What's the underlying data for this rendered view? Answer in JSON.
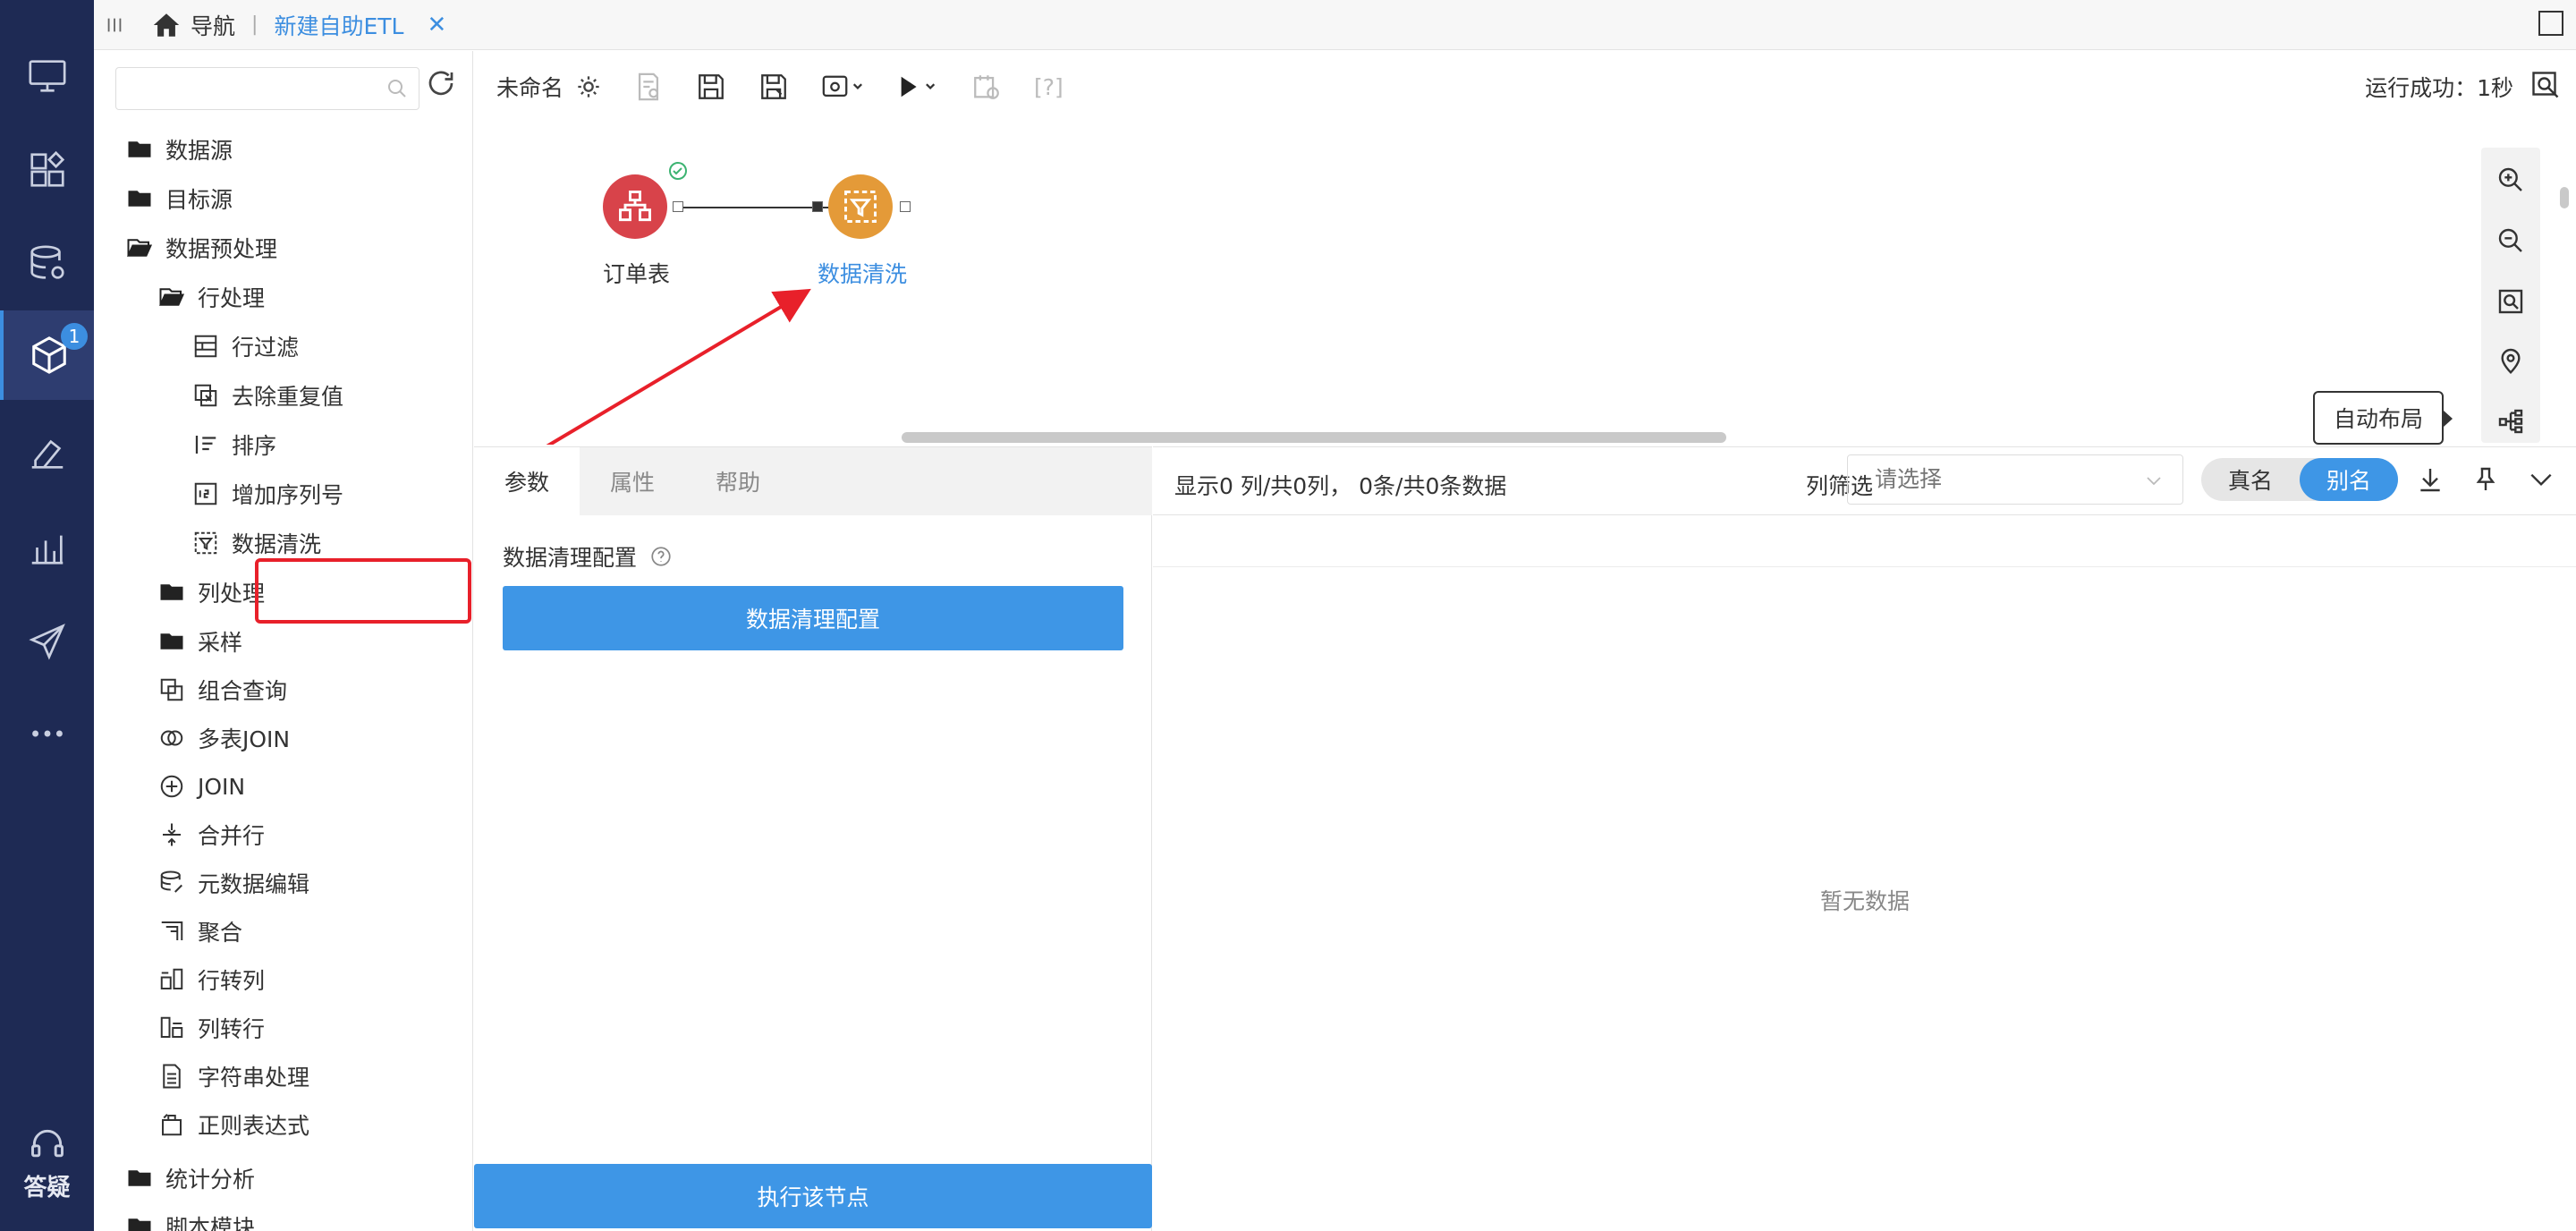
{
  "rail": {
    "badge_count": "1",
    "bottom_label": "答疑",
    "items": [
      "monitor-icon",
      "dashboard-icon",
      "database-settings-icon",
      "cube-etl-icon",
      "pen-tool-icon",
      "chart-bar-icon",
      "send-icon",
      "more-icon"
    ]
  },
  "topbar": {
    "home_label": "导航",
    "separator": "|",
    "tab_label": "新建自助ETL",
    "close": "✕"
  },
  "tree": {
    "search_placeholder": "",
    "items": [
      {
        "label": "数据源",
        "icon": "folder-icon"
      },
      {
        "label": "目标源",
        "icon": "folder-icon"
      },
      {
        "label": "数据预处理",
        "icon": "folder-open-icon"
      },
      {
        "label": "行处理",
        "icon": "folder-open-icon"
      },
      {
        "label": "行过滤",
        "icon": "row-filter-icon"
      },
      {
        "label": "去除重复值",
        "icon": "dedupe-icon"
      },
      {
        "label": "排序",
        "icon": "sort-icon"
      },
      {
        "label": "增加序列号",
        "icon": "serial-number-icon"
      },
      {
        "label": "数据清洗",
        "icon": "data-clean-icon"
      },
      {
        "label": "列处理",
        "icon": "folder-icon"
      },
      {
        "label": "采样",
        "icon": "folder-icon"
      },
      {
        "label": "组合查询",
        "icon": "combine-query-icon"
      },
      {
        "label": "多表JOIN",
        "icon": "multi-join-icon"
      },
      {
        "label": "JOIN",
        "icon": "join-icon"
      },
      {
        "label": "合并行",
        "icon": "merge-rows-icon"
      },
      {
        "label": "元数据编辑",
        "icon": "metadata-edit-icon"
      },
      {
        "label": "聚合",
        "icon": "aggregate-icon"
      },
      {
        "label": "行转列",
        "icon": "row-to-col-icon"
      },
      {
        "label": "列转行",
        "icon": "col-to-row-icon"
      },
      {
        "label": "字符串处理",
        "icon": "string-icon"
      },
      {
        "label": "正则表达式",
        "icon": "regex-icon"
      },
      {
        "label": "统计分析",
        "icon": "folder-icon"
      },
      {
        "label": "脚本模块",
        "icon": "folder-icon"
      }
    ]
  },
  "toolbar": {
    "name": "未命名",
    "status": "运行成功：1秒",
    "help_label": "[?]"
  },
  "canvas": {
    "nodes": [
      {
        "label": "订单表",
        "color": "#d8434a",
        "icon": "table-source-icon"
      },
      {
        "label": "数据清洗",
        "color": "#e49a38",
        "icon": "filter-clean-icon"
      }
    ],
    "tooltip": "自动布局"
  },
  "config": {
    "tabs": [
      "参数",
      "属性",
      "帮助"
    ],
    "section_label": "数据清理配置",
    "config_button": "数据清理配置",
    "execute_button": "执行该节点"
  },
  "preview": {
    "info": "显示0 列/共0列， 0条/共0条数据",
    "filter_label": "列筛选",
    "filter_placeholder": "请选择",
    "toggle_real": "真名",
    "toggle_alias": "别名",
    "empty": "暂无数据"
  },
  "colors": {
    "rail_bg": "#1e2a54",
    "accent": "#3e96e6",
    "highlight": "#e8202a"
  }
}
